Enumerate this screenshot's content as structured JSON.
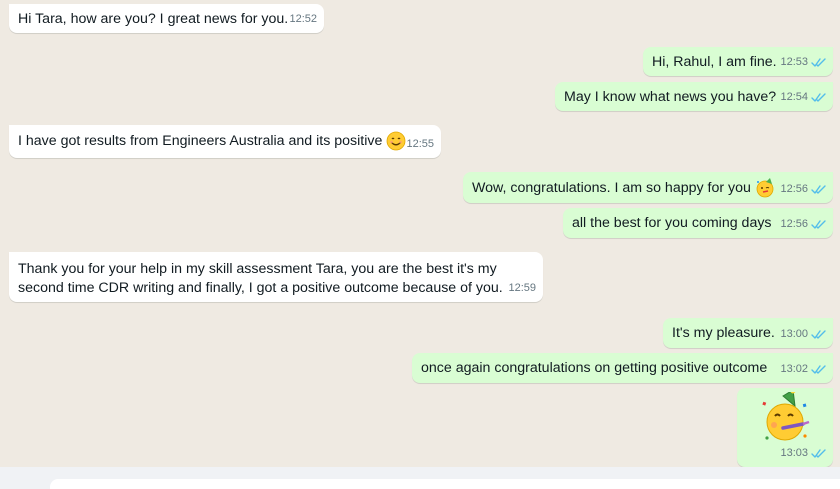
{
  "messages": [
    {
      "dir": "in",
      "text": "Hi Tara, how are you? I great news for you.",
      "time": "12:52"
    },
    {
      "dir": "out",
      "text": "Hi, Rahul, I am fine.",
      "time": "12:53"
    },
    {
      "dir": "out",
      "text": "May I know what news you have?",
      "time": "12:54"
    },
    {
      "dir": "in",
      "text": "I have got results from Engineers Australia and its positive",
      "time": "12:55",
      "emoji": "smiling-face-icon"
    },
    {
      "dir": "out",
      "text": "Wow, congratulations. I am so happy for you",
      "time": "12:56",
      "emoji": "party-face-icon"
    },
    {
      "dir": "out",
      "text": "all the best for you coming days",
      "time": "12:56"
    },
    {
      "dir": "in",
      "line1": "Thank you for your help in my skill assessment Tara, you are the best it's my",
      "line2": "second time CDR writing and finally, I got a positive outcome because of you.",
      "time": "12:59"
    },
    {
      "dir": "out",
      "text": "It's my pleasure.",
      "time": "13:00"
    },
    {
      "dir": "out",
      "text": "once again congratulations on getting positive outcome",
      "time": "13:02"
    },
    {
      "dir": "out",
      "sticker": "party-face-icon",
      "time": "13:03"
    }
  ],
  "colors": {
    "incoming": "#ffffff",
    "outgoing": "#d9fdd3",
    "read_tick": "#53bdeb",
    "background": "#efeae2"
  }
}
